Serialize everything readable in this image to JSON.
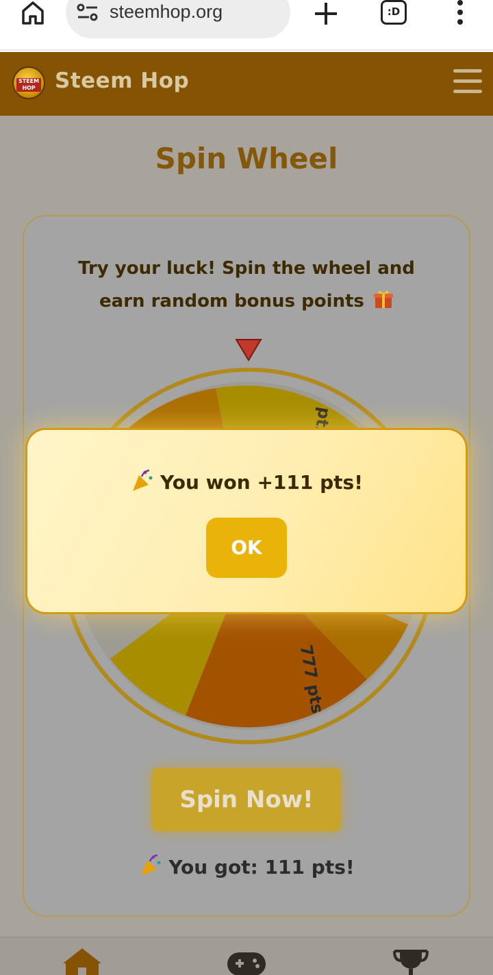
{
  "browser": {
    "url": "steemhop.org",
    "tab_switcher_label": ":D"
  },
  "header": {
    "logo_text": "STEEM HOP",
    "title": "Steem Hop"
  },
  "main": {
    "title": "Spin Wheel",
    "intro": "Try your luck! Spin the wheel and earn random bonus points",
    "wheel_segments": [
      "pts",
      "777 pts"
    ],
    "spin_label": "Spin Now!",
    "result_text": "You got: 111 pts!"
  },
  "modal": {
    "message": "You won +111 pts!",
    "ok_label": "OK"
  },
  "colors": {
    "brand_header": "#845404",
    "accent_gold": "#e9b30a",
    "title_brown": "#84570a"
  },
  "icons": {
    "gift": "gift-icon",
    "popper": "party-popper-icon"
  }
}
